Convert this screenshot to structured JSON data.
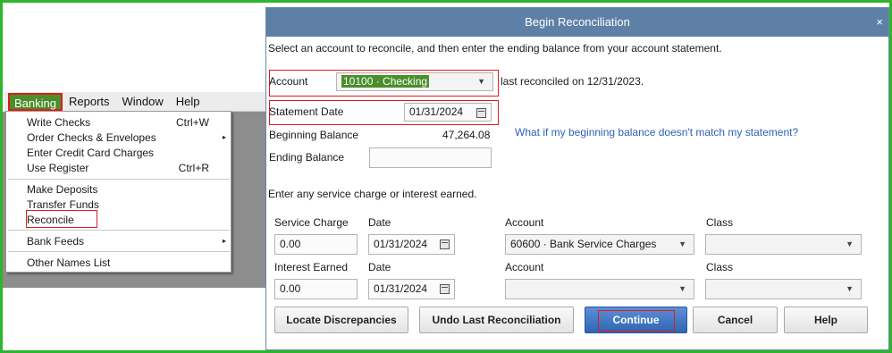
{
  "menu": {
    "items": [
      "Banking",
      "Reports",
      "Window",
      "Help"
    ],
    "banking_items": [
      {
        "label": "Write Checks",
        "shortcut": "Ctrl+W"
      },
      {
        "label": "Order Checks & Envelopes",
        "arrow": "▸"
      },
      {
        "label": "Enter Credit Card Charges"
      },
      {
        "label": "Use Register",
        "shortcut": "Ctrl+R"
      },
      {
        "label": "Make Deposits"
      },
      {
        "label": "Transfer Funds"
      },
      {
        "label": "Reconcile"
      },
      {
        "label": "Bank Feeds",
        "arrow": "▸"
      },
      {
        "label": "Other Names List"
      }
    ]
  },
  "dialog": {
    "title": "Begin Reconciliation",
    "close": "×",
    "instruction": "Select an account to reconcile, and then enter the ending balance from your account statement.",
    "account_label": "Account",
    "account_value": "10100 · Checking",
    "last_reconciled": "last reconciled on 12/31/2023.",
    "statement_date_label": "Statement Date",
    "statement_date": "01/31/2024",
    "beginning_balance_label": "Beginning Balance",
    "beginning_balance": "47,264.08",
    "help_link": "What if my beginning balance doesn't match my statement?",
    "ending_balance_label": "Ending Balance",
    "ending_balance": "",
    "service_instruction": "Enter any service charge or interest earned.",
    "service_charge": {
      "label": "Service Charge",
      "value": "0.00",
      "date_label": "Date",
      "date": "01/31/2024",
      "account_label": "Account",
      "account": "60600 · Bank Service Charges",
      "class_label": "Class",
      "class": ""
    },
    "interest": {
      "label": "Interest Earned",
      "value": "0.00",
      "date_label": "Date",
      "date": "01/31/2024",
      "account_label": "Account",
      "account": "",
      "class_label": "Class",
      "class": ""
    },
    "buttons": {
      "locate": "Locate Discrepancies",
      "undo": "Undo Last Reconciliation",
      "continue": "Continue",
      "cancel": "Cancel",
      "help": "Help"
    }
  },
  "colors": {
    "frame": "#2db52d",
    "titlebar": "#5f80a6",
    "highlight": "#e01b1b",
    "selection": "#4a8f2a",
    "link": "#2c62b7"
  }
}
